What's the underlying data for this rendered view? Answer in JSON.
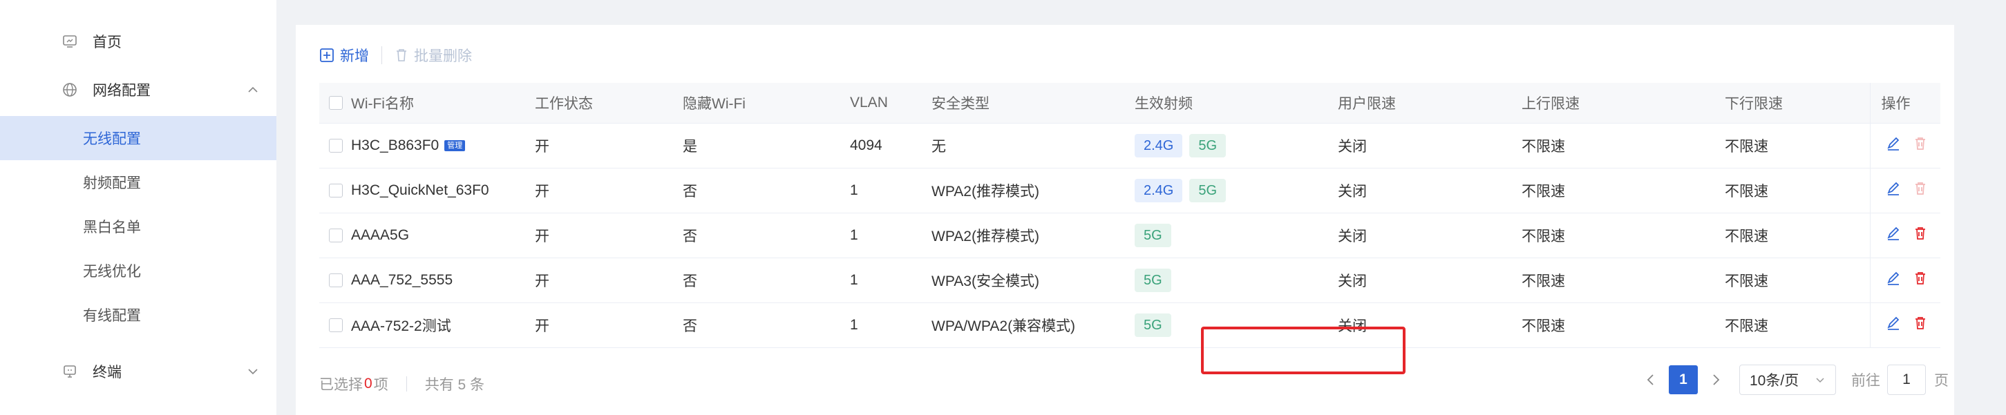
{
  "sidebar": {
    "items": [
      {
        "label": "首页",
        "icon": "home-monitor-icon"
      },
      {
        "label": "网络配置",
        "icon": "globe-icon",
        "expanded": true
      },
      {
        "label": "无线配置",
        "active": true
      },
      {
        "label": "射频配置"
      },
      {
        "label": "黑白名单"
      },
      {
        "label": "无线优化"
      },
      {
        "label": "有线配置"
      },
      {
        "label": "终端",
        "icon": "terminal-device-icon",
        "expanded": false
      }
    ]
  },
  "toolbar": {
    "add_label": "新增",
    "batch_delete_label": "批量删除"
  },
  "table": {
    "headers": [
      "Wi-Fi名称",
      "工作状态",
      "隐藏Wi-Fi",
      "VLAN",
      "安全类型",
      "生效射频",
      "用户限速",
      "上行限速",
      "下行限速",
      "操作"
    ],
    "mgmt_tag": "管理",
    "rows": [
      {
        "name": "H3C_B863F0",
        "mgmt": true,
        "status": "开",
        "hidden": "是",
        "vlan": "4094",
        "security": "无",
        "band1": "2.4G",
        "band2": "5G",
        "user_limit": "关闭",
        "up": "不限速",
        "down": "不限速",
        "deletable": false
      },
      {
        "name": "H3C_QuickNet_63F0",
        "mgmt": false,
        "status": "开",
        "hidden": "否",
        "vlan": "1",
        "security": "WPA2(推荐模式)",
        "band1": "2.4G",
        "band2": "5G",
        "user_limit": "关闭",
        "up": "不限速",
        "down": "不限速",
        "deletable": false
      },
      {
        "name": "AAAA5G",
        "mgmt": false,
        "status": "开",
        "hidden": "否",
        "vlan": "1",
        "security": "WPA2(推荐模式)",
        "band1": "",
        "band2": "5G",
        "user_limit": "关闭",
        "up": "不限速",
        "down": "不限速",
        "deletable": true
      },
      {
        "name": "AAA_752_5555",
        "mgmt": false,
        "status": "开",
        "hidden": "否",
        "vlan": "1",
        "security": "WPA3(安全模式)",
        "band1": "",
        "band2": "5G",
        "user_limit": "关闭",
        "up": "不限速",
        "down": "不限速",
        "deletable": true
      },
      {
        "name": "AAA-752-2测试",
        "mgmt": false,
        "status": "开",
        "hidden": "否",
        "vlan": "1",
        "security": "WPA/WPA2(兼容模式)",
        "band1": "",
        "band2": "5G",
        "user_limit": "关闭",
        "up": "不限速",
        "down": "不限速",
        "deletable": true
      }
    ]
  },
  "footer": {
    "selected_prefix": "已选择",
    "selected_count": "0",
    "selected_suffix": "项",
    "total_text": "共有 5 条"
  },
  "pagination": {
    "current_page": "1",
    "page_size": "10条/页",
    "goto_label": "前往",
    "goto_value": "1",
    "page_unit": "页"
  },
  "colors": {
    "primary": "#2e66d6",
    "highlight_border": "#e5262a",
    "delete_active": "#e5262a",
    "delete_disabled": "#f3b8b8"
  }
}
